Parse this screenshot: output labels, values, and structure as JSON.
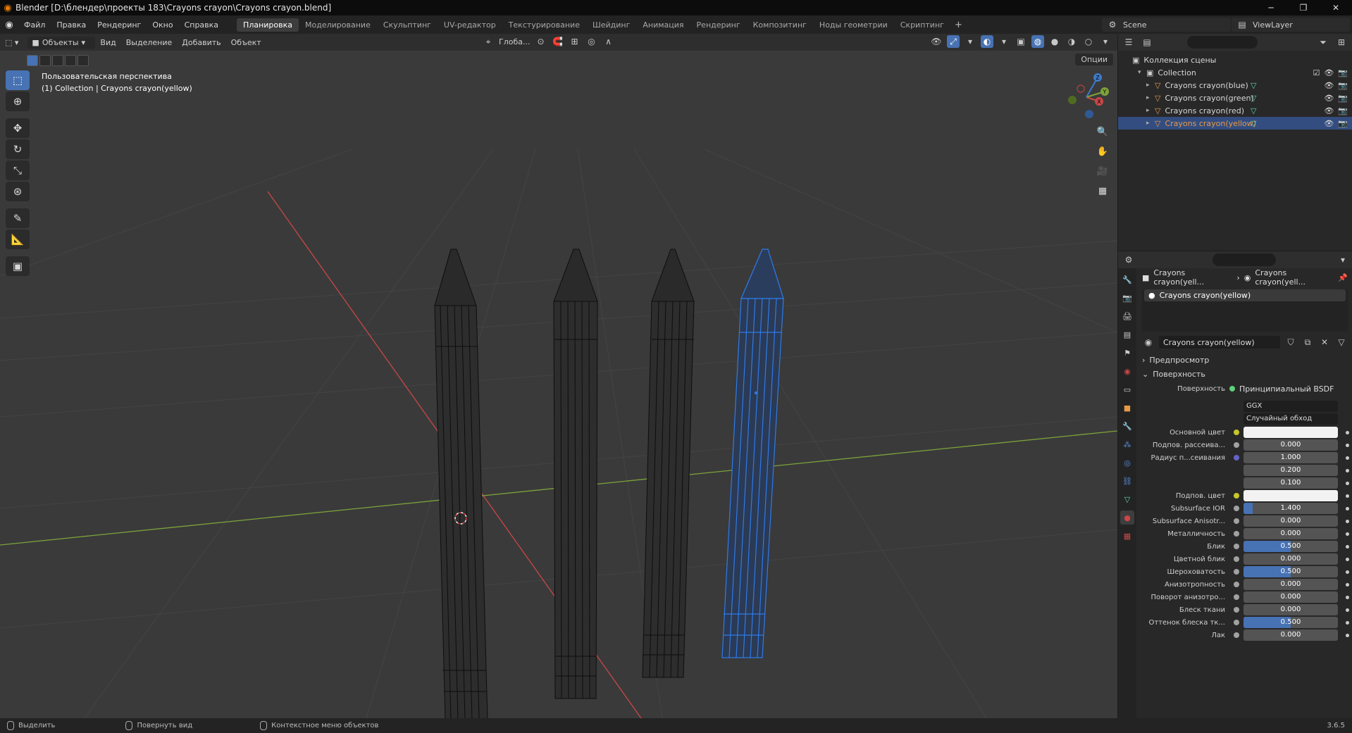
{
  "window": {
    "title": "Blender [D:\\блендер\\проекты 183\\Crayons crayon\\Crayons crayon.blend]",
    "logo_icon": "blender-logo-icon"
  },
  "menubar": {
    "menus": [
      "Файл",
      "Правка",
      "Рендеринг",
      "Окно",
      "Справка"
    ],
    "workspaces": [
      "Планировка",
      "Моделирование",
      "Скульптинг",
      "UV-редактор",
      "Текстурирование",
      "Шейдинг",
      "Анимация",
      "Рендеринг",
      "Композитинг",
      "Ноды геометрии",
      "Скриптинг"
    ],
    "active_workspace": "Планировка",
    "scene": "Scene",
    "view_layer": "ViewLayer"
  },
  "viewport": {
    "mode": "Объекты",
    "menus": [
      "Вид",
      "Выделение",
      "Добавить",
      "Объект"
    ],
    "transform_orientation": "Глоба...",
    "options": "Опции",
    "view_name": "Пользовательская перспектива",
    "view_context": "(1) Collection | Crayons crayon(yellow)",
    "gizmo": {
      "x": "X",
      "y": "Y",
      "z": "Z"
    },
    "colors": {
      "selected": "#2f7be8",
      "wire": "#0d0d0d",
      "x_axis": "#c94747",
      "y_axis": "#7da33a",
      "bg": "#3a3a3a"
    }
  },
  "toolbar": {
    "tools": [
      "select-box-icon",
      "cursor-icon",
      "move-icon",
      "rotate-icon",
      "scale-icon",
      "transform-icon",
      "annotate-icon",
      "measure-icon",
      "add-cube-icon"
    ]
  },
  "outliner": {
    "root": "Коллекция сцены",
    "collection": "Collection",
    "items": [
      {
        "name": "Crayons crayon(blue)",
        "selected": false
      },
      {
        "name": "Crayons crayon(green)",
        "selected": false
      },
      {
        "name": "Crayons crayon(red)",
        "selected": false
      },
      {
        "name": "Crayons crayon(yellow)",
        "selected": true
      }
    ]
  },
  "properties": {
    "breadcrumb_object": "Crayons crayon(yell...",
    "breadcrumb_material": "Crayons crayon(yell...",
    "material_slot": "Crayons crayon(yellow)",
    "material_name": "Crayons crayon(yellow)",
    "panels": {
      "preview": "Предпросмотр",
      "surface": "Поверхность"
    },
    "surface_label": "Поверхность",
    "shader": "Принципиальный BSDF",
    "distribution": "GGX",
    "subsurface_method": "Случайный обход",
    "fields": [
      {
        "label": "Основной цвет",
        "type": "color",
        "socket": "yellow"
      },
      {
        "label": "Подпов. рассеива...",
        "value": "0.000",
        "fill": 0,
        "socket": "grey"
      },
      {
        "label": "Радиус п...сеивания",
        "value": "1.000",
        "fill": 0,
        "socket": "blue"
      },
      {
        "label": "",
        "value": "0.200",
        "fill": 0,
        "socket": "none"
      },
      {
        "label": "",
        "value": "0.100",
        "fill": 0,
        "socket": "none"
      },
      {
        "label": "Подпов. цвет",
        "type": "color",
        "socket": "yellow"
      },
      {
        "label": "Subsurface IOR",
        "value": "1.400",
        "fill": 0.1,
        "socket": "grey"
      },
      {
        "label": "Subsurface Anisotr...",
        "value": "0.000",
        "fill": 0,
        "socket": "grey"
      },
      {
        "label": "Металличность",
        "value": "0.000",
        "fill": 0,
        "socket": "grey"
      },
      {
        "label": "Блик",
        "value": "0.500",
        "fill": 0.5,
        "socket": "grey"
      },
      {
        "label": "Цветной блик",
        "value": "0.000",
        "fill": 0,
        "socket": "grey"
      },
      {
        "label": "Шероховатость",
        "value": "0.500",
        "fill": 0.5,
        "socket": "grey"
      },
      {
        "label": "Анизотропность",
        "value": "0.000",
        "fill": 0,
        "socket": "grey"
      },
      {
        "label": "Поворот анизотро...",
        "value": "0.000",
        "fill": 0,
        "socket": "grey"
      },
      {
        "label": "Блеск ткани",
        "value": "0.000",
        "fill": 0,
        "socket": "grey"
      },
      {
        "label": "Оттенок блеска тк...",
        "value": "0.500",
        "fill": 0.5,
        "socket": "grey"
      },
      {
        "label": "Лак",
        "value": "0.000",
        "fill": 0,
        "socket": "grey"
      }
    ]
  },
  "statusbar": {
    "select": "Выделить",
    "rotate": "Повернуть вид",
    "context_menu": "Контекстное меню объектов",
    "version": "3.6.5"
  }
}
